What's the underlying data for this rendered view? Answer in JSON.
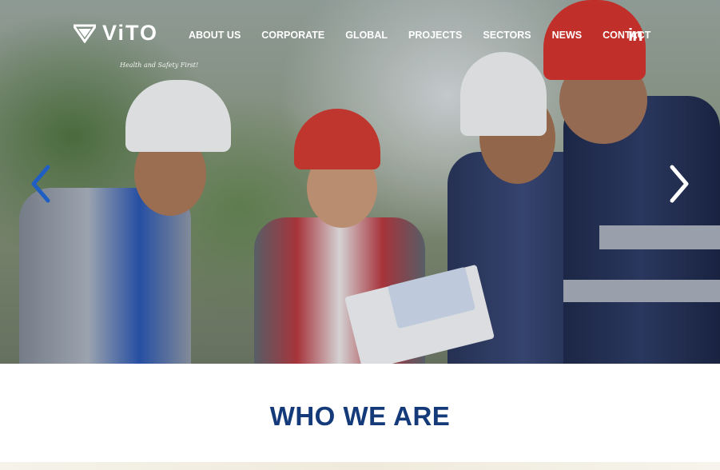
{
  "brand": {
    "name": "ViTO",
    "tagline": "Health and Safety First!",
    "accent": "#143a7a"
  },
  "nav": {
    "items": [
      {
        "label": "ABOUT US"
      },
      {
        "label": "CORPORATE"
      },
      {
        "label": "GLOBAL"
      },
      {
        "label": "PROJECTS"
      },
      {
        "label": "SECTORS"
      },
      {
        "label": "NEWS"
      },
      {
        "label": "CONTACT"
      }
    ],
    "social": {
      "label": "in",
      "icon": "linkedin-icon"
    }
  },
  "hero": {
    "prev_icon": "chevron-left-icon",
    "next_icon": "chevron-right-icon"
  },
  "section": {
    "title": "WHO WE ARE"
  }
}
